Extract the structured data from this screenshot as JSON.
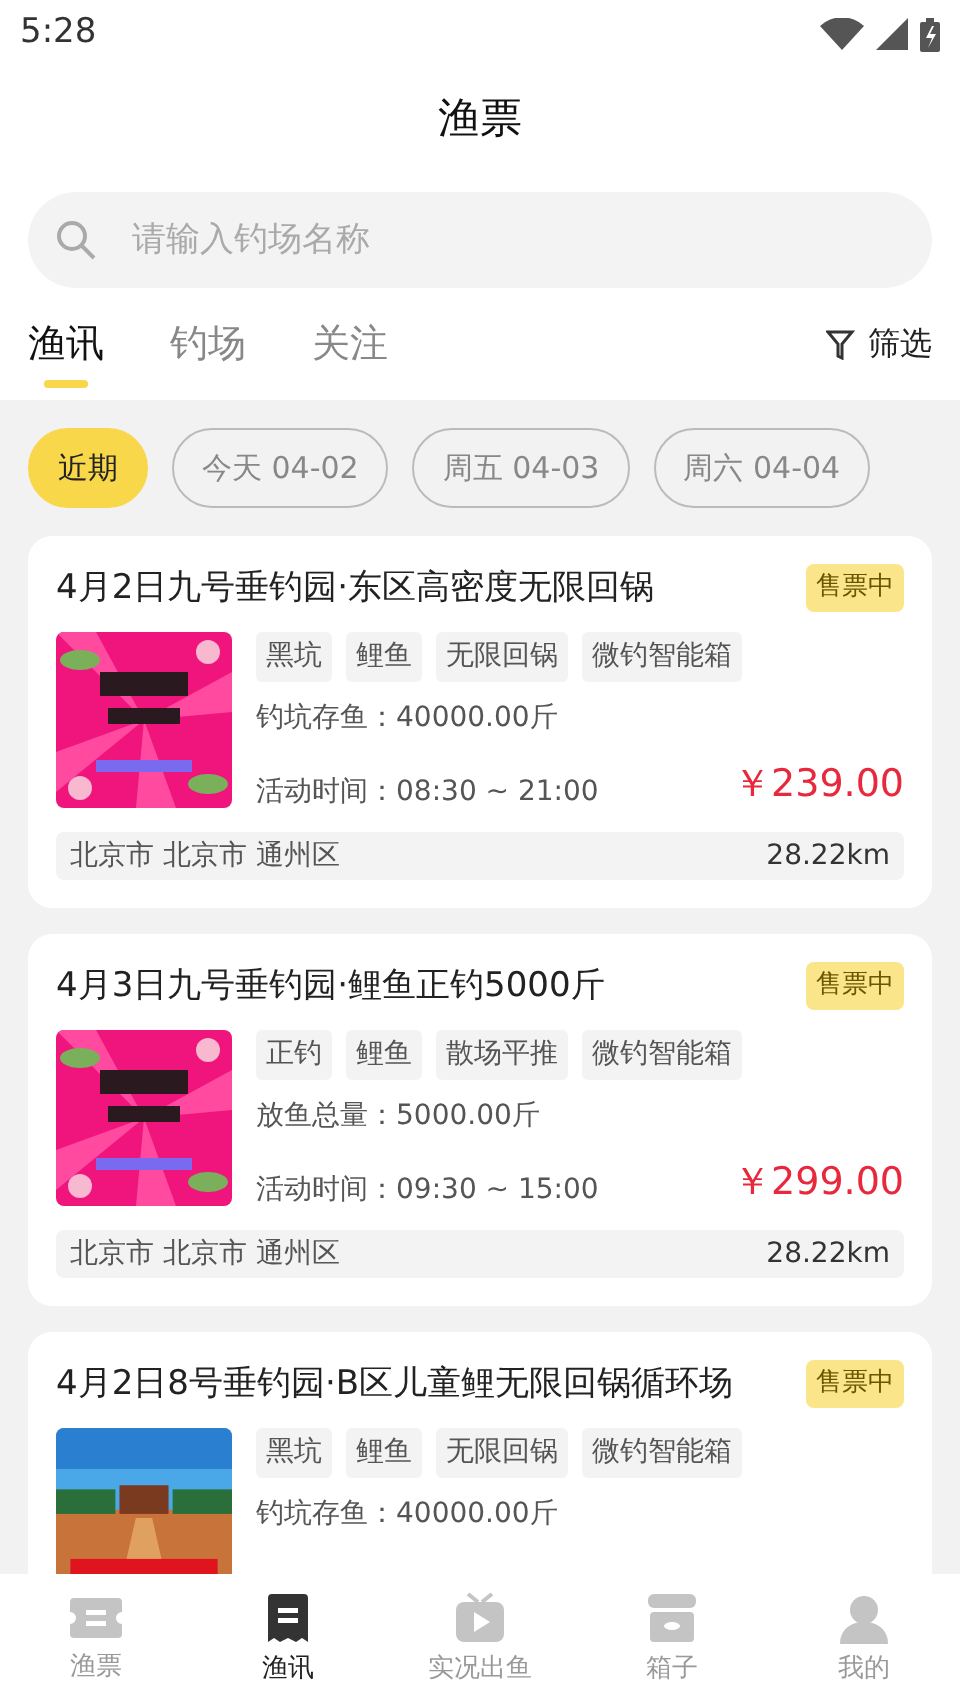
{
  "status_bar": {
    "time": "5:28"
  },
  "header": {
    "title": "渔票"
  },
  "search": {
    "placeholder": "请输入钓场名称"
  },
  "tabs": [
    {
      "label": "渔讯",
      "selected": true
    },
    {
      "label": "钓场",
      "selected": false
    },
    {
      "label": "关注",
      "selected": false
    }
  ],
  "filter": {
    "label": "筛选"
  },
  "date_chips": [
    {
      "label": "近期",
      "selected": true
    },
    {
      "label": "今天 04-02",
      "selected": false
    },
    {
      "label": "周五 04-03",
      "selected": false
    },
    {
      "label": "周六 04-04",
      "selected": false
    }
  ],
  "cards": [
    {
      "title": "4月2日九号垂钓园·东区高密度无限回锅",
      "badge": "售票中",
      "picture": {
        "kind": "picture"
      },
      "tags": [
        "黑坑",
        "鲤鱼",
        "无限回锅",
        "微钓智能箱"
      ],
      "info": [
        "钓坑存鱼：40000.00斤",
        "活动时间：08:30 ~ 21:00"
      ],
      "price": "￥239.00",
      "location": "北京市 北京市 通州区",
      "distance": "28.22km"
    },
    {
      "title": "4月3日九号垂钓园·鲤鱼正钓5000斤",
      "badge": "售票中",
      "picture": {
        "kind": "picture"
      },
      "tags": [
        "正钓",
        "鲤鱼",
        "散场平推",
        "微钓智能箱"
      ],
      "info": [
        "放鱼总量：5000.00斤",
        "活动时间：09:30 ~ 15:00"
      ],
      "price": "￥299.00",
      "location": "北京市 北京市 通州区",
      "distance": "28.22km"
    },
    {
      "title": "4月2日8号垂钓园·B区儿童鲤无限回锅循环场",
      "badge": "售票中",
      "picture": {
        "kind": "picture"
      },
      "tags": [
        "黑坑",
        "鲤鱼",
        "无限回锅",
        "微钓智能箱"
      ],
      "info": [
        "钓坑存鱼：40000.00斤"
      ]
    }
  ],
  "bottom_nav": [
    {
      "label": "渔票",
      "selected": false
    },
    {
      "label": "渔讯",
      "selected": true
    },
    {
      "label": "实况出鱼",
      "selected": false
    },
    {
      "label": "箱子",
      "selected": false
    },
    {
      "label": "我的",
      "selected": false
    }
  ]
}
